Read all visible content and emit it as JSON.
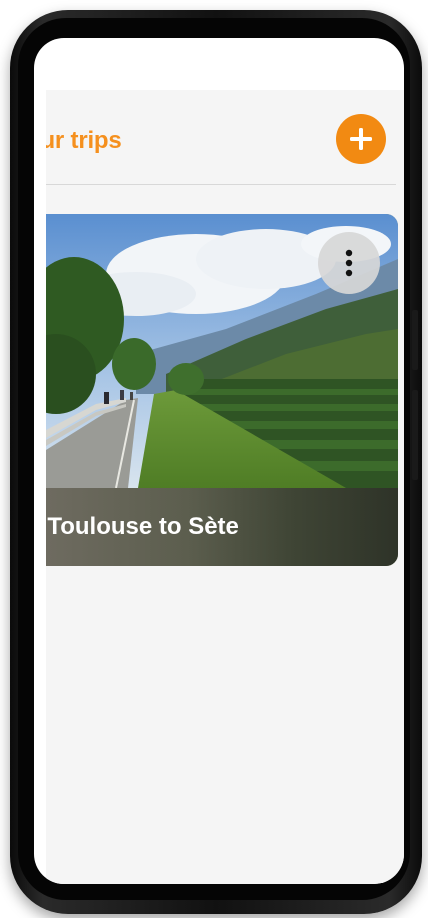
{
  "header": {
    "title": "our trips",
    "add_icon": "plus-icon"
  },
  "trips": [
    {
      "title": "n Toulouse to Sète",
      "menu_icon": "more-vertical-icon"
    }
  ],
  "colors": {
    "accent": "#f28a12",
    "title": "#f5901e",
    "background": "#f5f5f5"
  }
}
